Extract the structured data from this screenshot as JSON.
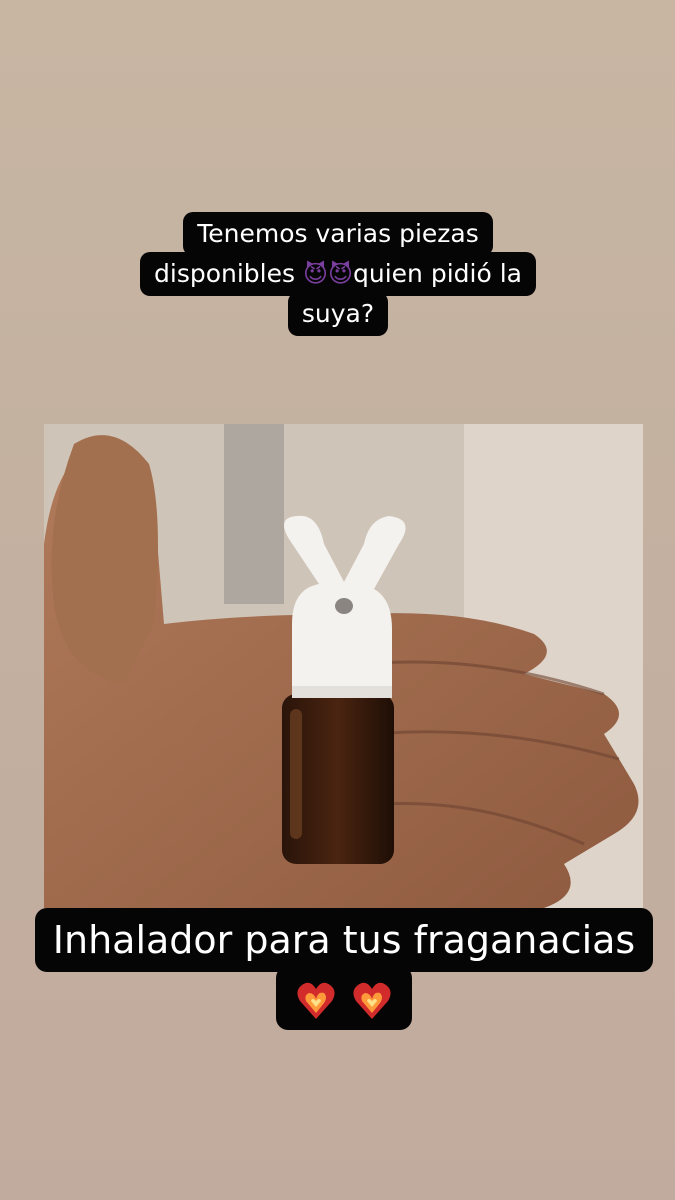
{
  "story": {
    "top_caption": {
      "line1": "Tenemos varias piezas",
      "line2_a": "disponibles ",
      "emoji_devil": "😈😈",
      "line2_b": "quien pidió la",
      "line3": "suya?"
    },
    "photo": {
      "icon": "hand-holding-inhaler-bottle"
    },
    "bottom_caption": {
      "line1": "Inhalador para tus fraganacias",
      "emoji_hearts": "❤️‍🔥❤️‍🔥"
    }
  }
}
